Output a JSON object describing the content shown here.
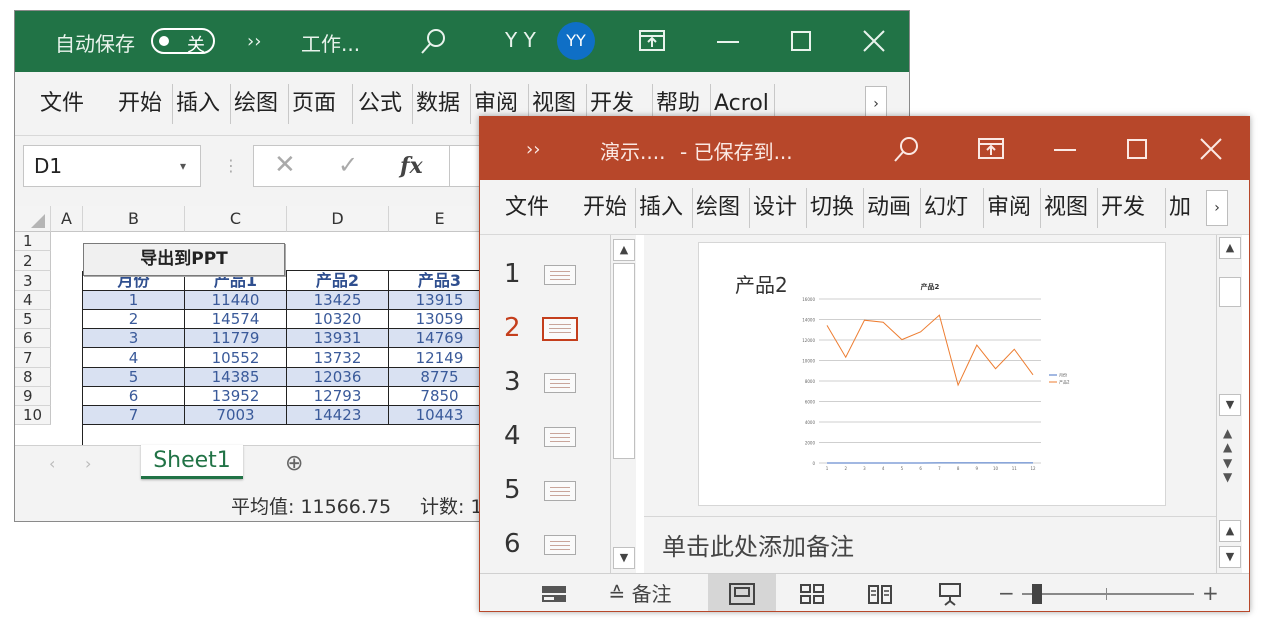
{
  "excel": {
    "autosave_label": "自动保存",
    "autosave_state": "关",
    "more": "››",
    "file_name": "工作...",
    "user_initials": "Y Y",
    "avatar": "YY",
    "menu": [
      "文件",
      "开始",
      "插入",
      "绘图",
      "页面布局",
      "公式",
      "数据",
      "审阅",
      "视图",
      "开发工具",
      "帮助",
      "Acrol"
    ],
    "menu_more": "›",
    "name_box": "D1",
    "fx": "fx",
    "columns": [
      "A",
      "B",
      "C",
      "D",
      "E"
    ],
    "rows": [
      "1",
      "2",
      "3",
      "4",
      "5",
      "6",
      "7",
      "8",
      "9",
      "10"
    ],
    "button_label": "导出到PPT",
    "table_headers": [
      "月份",
      "产品1",
      "产品2",
      "产品3"
    ],
    "table_rows": [
      [
        "1",
        "11440",
        "13425",
        "13915"
      ],
      [
        "2",
        "14574",
        "10320",
        "13059"
      ],
      [
        "3",
        "11779",
        "13931",
        "14769"
      ],
      [
        "4",
        "10552",
        "13732",
        "12149"
      ],
      [
        "5",
        "14385",
        "12036",
        "8775"
      ],
      [
        "6",
        "13952",
        "12793",
        "7850"
      ],
      [
        "7",
        "7003",
        "14423",
        "10443"
      ]
    ],
    "sheet_tab": "Sheet1",
    "add_sheet": "⊕",
    "status_avg": "平均值: 11566.75",
    "status_count": "计数: 1",
    "colors": {
      "title_bar": "#217346",
      "band": "#d9e1f2"
    }
  },
  "ppt": {
    "more": "››",
    "file_name": "演示....",
    "saved_status": "- 已保存到...",
    "menu": [
      "文件",
      "开始",
      "插入",
      "绘图",
      "设计",
      "切换",
      "动画",
      "幻灯片放映",
      "审阅",
      "视图",
      "开发工具",
      "加载项"
    ],
    "menu_more": "›",
    "slides": [
      "1",
      "2",
      "3",
      "4",
      "5",
      "6"
    ],
    "active_slide": 2,
    "slide_title": "产品2",
    "notes_placeholder": "单击此处添加备注",
    "status_notes": "备注",
    "zoom_minus": "−",
    "zoom_plus": "+",
    "colors": {
      "title_bar": "#b7472a",
      "active": "#c43e1c",
      "series1": "#4472c4",
      "series2": "#ed7d31"
    }
  },
  "chart_data": {
    "type": "line",
    "title": "产品2",
    "categories": [
      "1",
      "2",
      "3",
      "4",
      "5",
      "6",
      "7",
      "8",
      "9",
      "10",
      "11",
      "12"
    ],
    "y_ticks": [
      "0",
      "2000",
      "4000",
      "6000",
      "8000",
      "10000",
      "12000",
      "14000",
      "16000"
    ],
    "ylim": [
      0,
      16000
    ],
    "grid": true,
    "legend_position": "right",
    "series": [
      {
        "name": "月份",
        "values": [
          1,
          2,
          3,
          4,
          5,
          6,
          7,
          8,
          9,
          10,
          11,
          12
        ]
      },
      {
        "name": "产品2",
        "values": [
          13425,
          10320,
          13931,
          13732,
          12036,
          12793,
          14423,
          7600,
          11500,
          9200,
          11100,
          8600
        ]
      }
    ]
  }
}
